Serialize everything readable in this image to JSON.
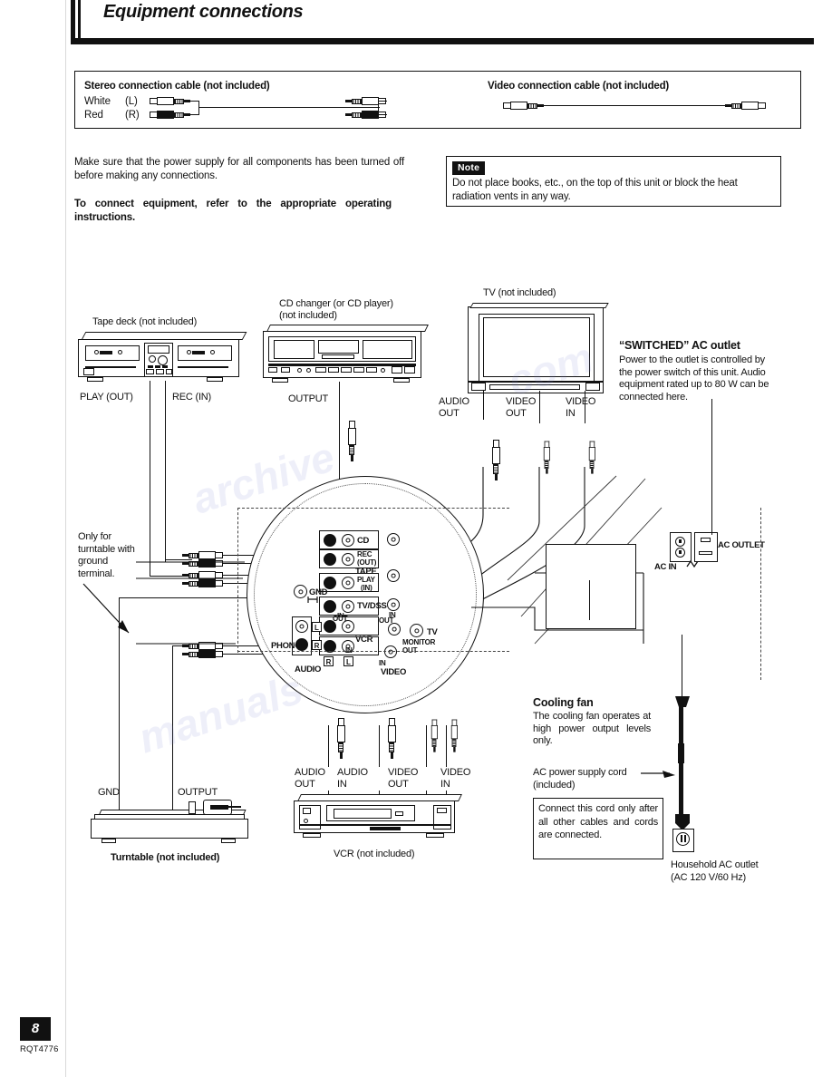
{
  "header": {
    "title": "Equipment connections"
  },
  "cable_legend": {
    "stereo": {
      "title": "Stereo connection cable (not included)",
      "rows": [
        {
          "color": "White",
          "channel": "(L)"
        },
        {
          "color": "Red",
          "channel": "(R)"
        }
      ]
    },
    "video": {
      "title": "Video connection cable (not included)"
    }
  },
  "intro": {
    "paragraph": "Make sure that the power supply for all components has been turned off before making any connections.",
    "bold_paragraph": "To connect equipment, refer to the appropriate operating instructions."
  },
  "note": {
    "badge": "Note",
    "text": "Do not place books, etc., on the top of this unit or block the heat radiation vents in any way."
  },
  "devices": {
    "tape_deck": {
      "caption": "Tape deck (not included)",
      "port_left": "PLAY (OUT)",
      "port_right": "REC (IN)"
    },
    "cd_changer": {
      "caption_line1": "CD changer (or CD player)",
      "caption_line2": "(not included)",
      "port": "OUTPUT"
    },
    "tv": {
      "caption": "TV (not included)",
      "ports": [
        "AUDIO OUT",
        "VIDEO OUT",
        "VIDEO IN"
      ]
    },
    "vcr": {
      "caption": "VCR (not included)",
      "ports": [
        "AUDIO OUT",
        "AUDIO IN",
        "VIDEO OUT",
        "VIDEO IN"
      ]
    },
    "turntable": {
      "caption": "Turntable (not included)",
      "port_gnd": "GND",
      "port_output": "OUTPUT"
    }
  },
  "notes_diagram": {
    "ground_note": "Only for turntable with ground terminal.",
    "switched_outlet": {
      "heading": "“SWITCHED” AC outlet",
      "body": "Power to the outlet is controlled by the power switch of this unit. Audio equipment rated up to 80 W can be connected here."
    },
    "cooling_fan": {
      "heading": "Cooling fan",
      "body": "The cooling fan operates at high power output levels only."
    },
    "power_cord": {
      "label_line1": "AC power supply cord",
      "label_line2": "(included)",
      "callout": "Connect this cord only after all other cables and cords are connected."
    },
    "household": {
      "line1": "Household AC outlet",
      "line2": "(AC 120 V/60 Hz)"
    },
    "ac_in": "AC IN",
    "ac_outlet": "AC OUTLET"
  },
  "jack_panel": {
    "rows": [
      {
        "name": "CD",
        "label": "CD",
        "sub": ""
      },
      {
        "name": "REC_OUT",
        "label": "REC",
        "sub": "(OUT)"
      },
      {
        "name": "TAPE_PLAY_IN",
        "label": "PLAY",
        "sub": "(IN)",
        "group": "TAPE"
      },
      {
        "name": "TV_DSS",
        "label": "TV/DSS",
        "sub": "IN"
      },
      {
        "name": "VCR_OUT",
        "label": "OUT",
        "sub": ""
      },
      {
        "name": "VCR_IN",
        "label": "IN",
        "sub": "",
        "group": "VCR"
      }
    ],
    "group_tape": "TAPE",
    "group_vcr": "VCR",
    "phono": "PHONO",
    "gnd": "GND",
    "audio": "AUDIO",
    "video": "VIDEO",
    "video_in": "IN",
    "tv_monitor_out_line1": "TV",
    "tv_monitor_out_line2": "MONITOR OUT",
    "right_in": "IN",
    "right_out": "OUT",
    "lr": {
      "left": "L",
      "right": "R"
    }
  },
  "footer": {
    "page": "8",
    "code": "RQT4776"
  }
}
